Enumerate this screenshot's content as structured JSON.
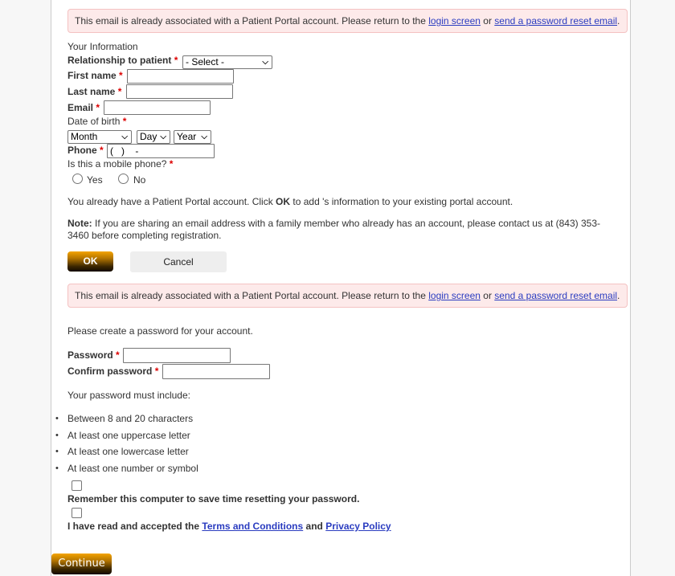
{
  "alert": {
    "text_before": "This email is already associated with a Patient Portal account. Please return to the ",
    "login_link": "login screen",
    "text_mid": " or ",
    "reset_link": "send a password reset email",
    "text_after": "."
  },
  "your_info": {
    "section_title": "Your Information",
    "relationship_label": "Relationship to patient",
    "relationship_value": "- Select -",
    "first_name_label": "First name",
    "first_name_value": "",
    "last_name_label": "Last name",
    "last_name_value": "",
    "email_label": "Email",
    "email_value": "",
    "dob_label": "Date of birth",
    "dob_month": "Month",
    "dob_day": "Day",
    "dob_year": "Year",
    "phone_label": "Phone",
    "phone_value": "(   )    -",
    "mobile_question": "Is this a mobile phone?",
    "mobile_yes": "Yes",
    "mobile_no": "No",
    "required_mark": "*"
  },
  "existing_account": {
    "text_before": "You already have a Patient Portal account. Click ",
    "ok_word": "OK",
    "text_after": " to add 's information to your existing portal account.",
    "note_label": "Note:",
    "note_text": " If you are sharing an email address with a family member who already has an account, please contact us at (843) 353-3460 before completing registration.",
    "ok_button": "OK",
    "cancel_button": "Cancel"
  },
  "password": {
    "intro": "Please create a password for your account.",
    "password_label": "Password",
    "confirm_label": "Confirm password",
    "must_include": "Your password must include:",
    "requirements": [
      "Between 8 and 20 characters",
      "At least one uppercase letter",
      "At least one lowercase letter",
      "At least one number or symbol"
    ],
    "remember_label": "Remember this computer to save time resetting your password.",
    "terms_before": "I have read and accepted the ",
    "terms_link": "Terms and Conditions",
    "terms_mid": " and ",
    "privacy_link": "Privacy Policy",
    "continue_button": "Continue"
  }
}
